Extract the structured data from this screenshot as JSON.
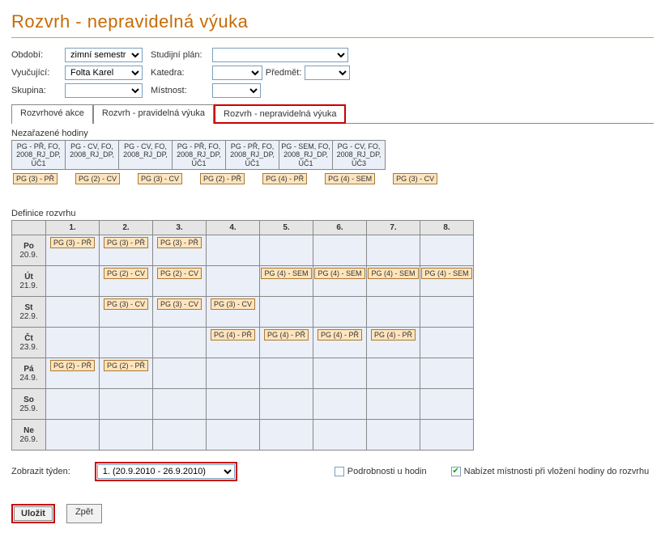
{
  "title": "Rozvrh - nepravidelná výuka",
  "filters": {
    "period_label": "Období:",
    "period_value": "zimní semestr",
    "teacher_label": "Vyučující:",
    "teacher_value": "Folta Karel",
    "group_label": "Skupina:",
    "plan_label": "Studijní plán:",
    "dept_label": "Katedra:",
    "subject_label": "Předmět:",
    "room_label": "Místnost:"
  },
  "tabs": {
    "t0": "Rozvrhové akce",
    "t1": "Rozvrh - pravidelná výuka",
    "t2": "Rozvrh - nepravidelná výuka"
  },
  "unassigned_title": "Nezařazené hodiny",
  "unassigned": [
    "PG - PŘ, FO, 2008_RJ_DP, ÚČ1",
    "PG - CV, FO, 2008_RJ_DP,",
    "PG - CV, FO, 2008_RJ_DP,",
    "PG - PŘ, FO, 2008_RJ_DP, ÚČ1",
    "PG - PŘ, FO, 2008_RJ_DP, ÚČ1",
    "PG - SEM, FO, 2008_RJ_DP, ÚČ1",
    "PG - CV, FO, 2008_RJ_DP, ÚČ3"
  ],
  "chips_top": [
    "PG (3) - PŘ",
    "PG (2) - CV",
    "PG (3) - CV",
    "PG (2) - PŘ",
    "PG (4) - PŘ",
    "PG (4) - SEM",
    "PG (3) - CV"
  ],
  "def_title": "Definice rozvrhu",
  "cols": [
    "1.",
    "2.",
    "3.",
    "4.",
    "5.",
    "6.",
    "7.",
    "8."
  ],
  "rows": [
    {
      "dow": "Po",
      "date": "20.9."
    },
    {
      "dow": "Út",
      "date": "21.9."
    },
    {
      "dow": "St",
      "date": "22.9."
    },
    {
      "dow": "Čt",
      "date": "23.9."
    },
    {
      "dow": "Pá",
      "date": "24.9."
    },
    {
      "dow": "So",
      "date": "25.9."
    },
    {
      "dow": "Ne",
      "date": "26.9."
    }
  ],
  "cells": {
    "r0c0": "PG (3) - PŘ",
    "r0c1": "PG (3) - PŘ",
    "r0c2": "PG (3) - PŘ",
    "r1c1": "PG (2) - CV",
    "r1c2": "PG (2) - CV",
    "r1c4": "PG (4) - SEM",
    "r1c5": "PG (4) - SEM",
    "r1c6": "PG (4) - SEM",
    "r1c7": "PG (4) - SEM",
    "r2c1": "PG (3) - CV",
    "r2c2": "PG (3) - CV",
    "r2c3": "PG (3) - CV",
    "r3c3": "PG (4) - PŘ",
    "r3c4": "PG (4) - PŘ",
    "r3c5": "PG (4) - PŘ",
    "r3c6": "PG (4) - PŘ",
    "r4c0": "PG (2) - PŘ",
    "r4c1": "PG (2) - PŘ"
  },
  "below": {
    "week_label": "Zobrazit týden:",
    "week_value": "1. (20.9.2010 - 26.9.2010)",
    "detail_label": "Podrobnosti u hodin",
    "offer_label": "Nabízet místnosti při vložení hodiny do rozvrhu"
  },
  "buttons": {
    "save": "Uložit",
    "back": "Zpět"
  }
}
